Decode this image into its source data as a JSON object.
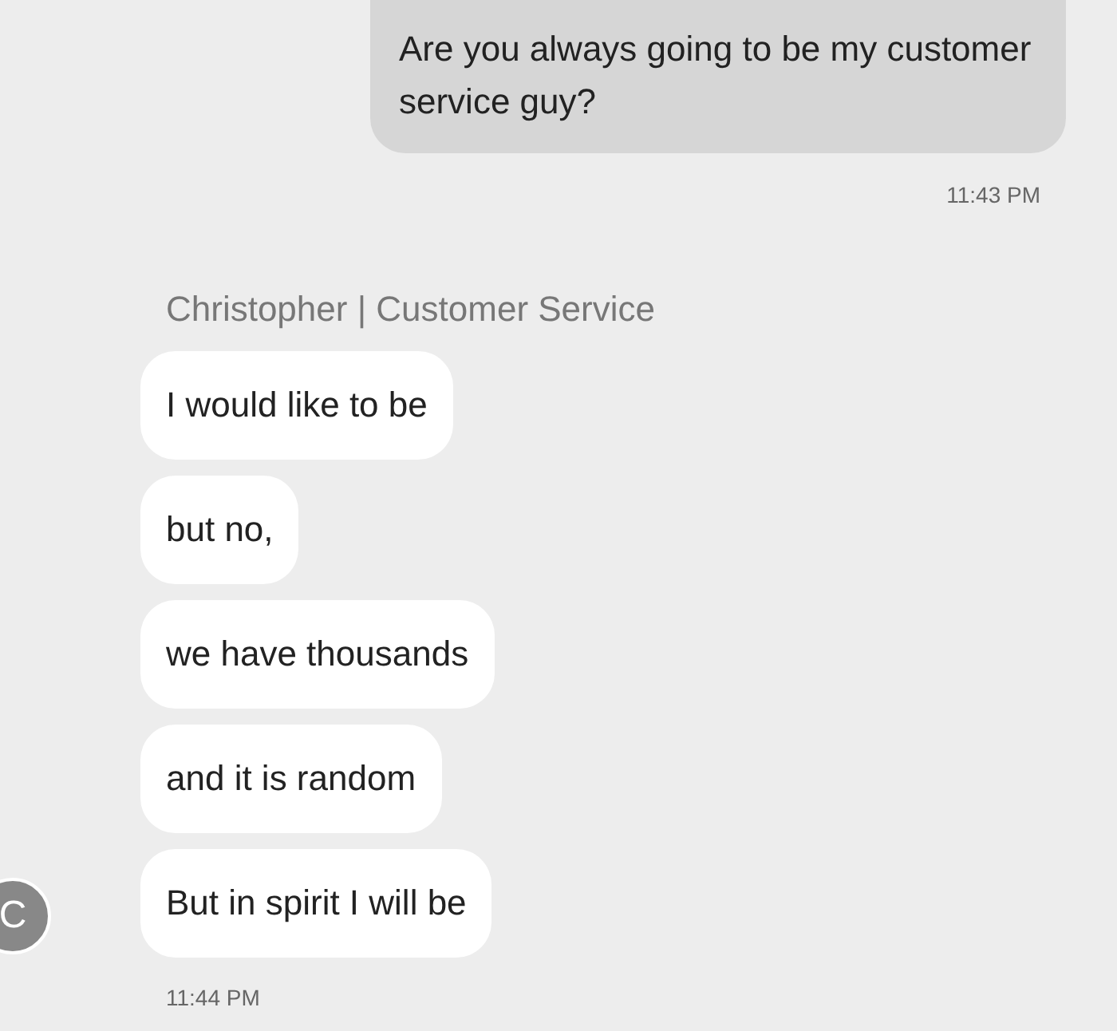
{
  "outgoing": {
    "text": "Are you always going to be my customer service guy?",
    "time": "11:43 PM"
  },
  "incoming": {
    "sender": "Christopher | Customer Service",
    "messages": [
      "I would like to be",
      "but no,",
      "we have thousands",
      "and it is random",
      "But in spirit I will be"
    ],
    "avatar": "C",
    "time": "11:44 PM"
  }
}
